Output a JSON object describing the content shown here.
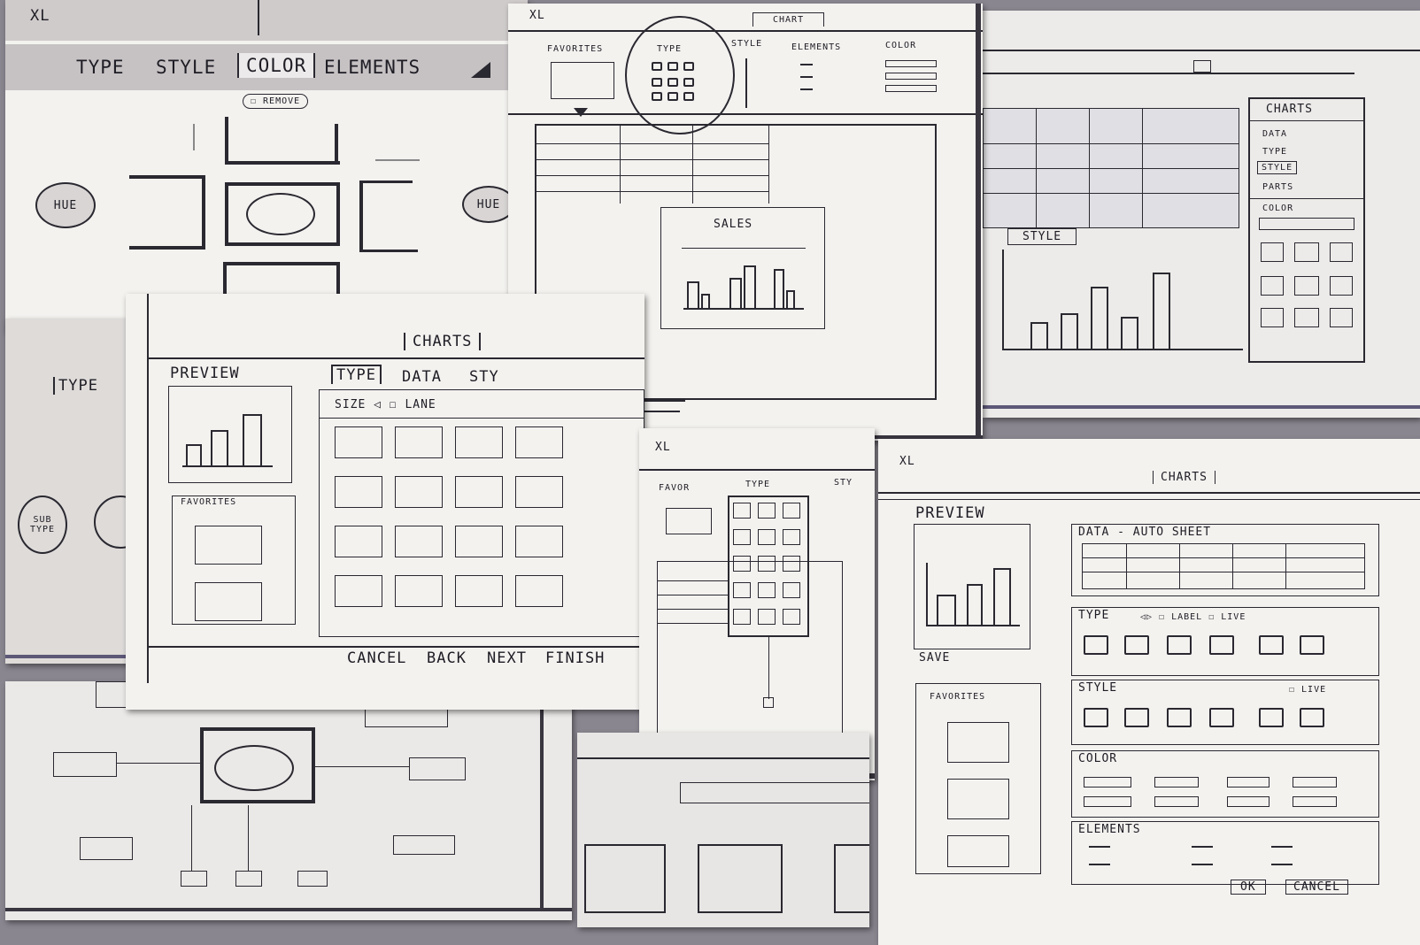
{
  "sketch_a": {
    "logo": "XL",
    "tabs": [
      "TYPE",
      "STYLE",
      "COLOR",
      "ELEMENTS"
    ],
    "sub_option": "☐ REMOVE",
    "hue_left": "HUE",
    "hue_right": "HUE"
  },
  "sketch_b": {
    "logo": "XL",
    "top_tab": "CHART",
    "ribbon": [
      "FAVORITES",
      "TYPE",
      "STYLE",
      "ELEMENTS",
      "COLOR"
    ],
    "chart_title": "SALES"
  },
  "sketch_c": {
    "panel_title": "CHARTS",
    "panel_items": [
      "DATA",
      "TYPE",
      "STYLE",
      "PARTS"
    ],
    "color_label": "COLOR",
    "style_label": "STYLE"
  },
  "sketch_d": {
    "partial_tab": "TYPE",
    "sub_type_label": "SUB TYPE"
  },
  "sketch_e": {
    "top_tab": "CHARTS",
    "preview_label": "PREVIEW",
    "favorites_label": "FAVORITES",
    "tabs": [
      "TYPE",
      "DATA",
      "STY"
    ],
    "options": "SIZE ◁ ☐ LANE",
    "buttons": [
      "CANCEL",
      "BACK",
      "NEXT",
      "FINISH"
    ]
  },
  "sketch_f": {
    "logo": "XL",
    "header": [
      "FAVOR",
      "TYPE",
      "STY"
    ]
  },
  "sketch_g": {
    "logo": "XL",
    "top_tab": "CHARTS",
    "preview_label": "PREVIEW",
    "save_label": "SAVE",
    "favorites_label": "FAVORITES",
    "data_label": "DATA - AUTO SHEET",
    "type_label": "TYPE",
    "type_options": "◁▷ ☐ LABEL ☐ LIVE",
    "style_label": "STYLE",
    "style_live": "☐ LIVE",
    "color_label": "COLOR",
    "elements_label": "ELEMENTS",
    "ok_button": "OK",
    "cancel_button": "CANCEL"
  }
}
